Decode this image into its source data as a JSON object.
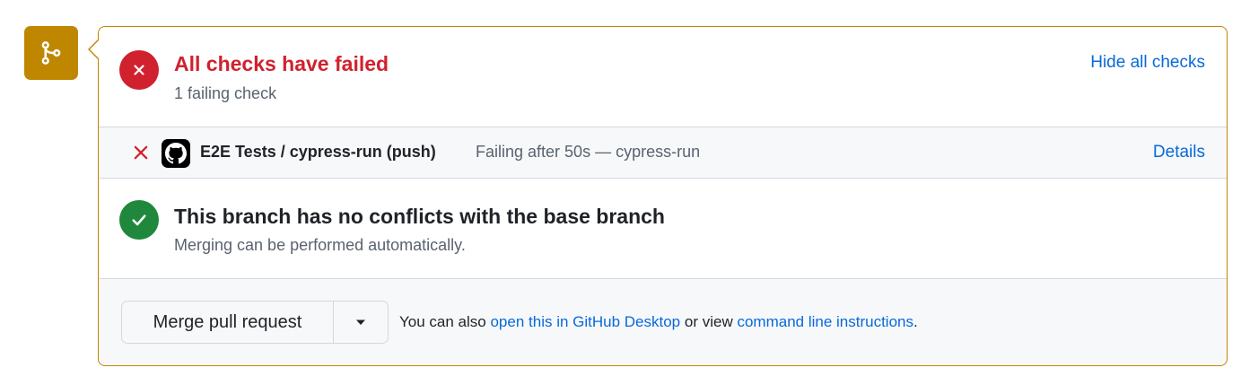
{
  "checks": {
    "title": "All checks have failed",
    "subtitle": "1 failing check",
    "toggle_label": "Hide all checks",
    "items": [
      {
        "name": "E2E Tests / cypress-run (push)",
        "description": "Failing after 50s — cypress-run",
        "details_label": "Details",
        "status": "failed",
        "icon": "github-icon"
      }
    ]
  },
  "branch": {
    "title": "This branch has no conflicts with the base branch",
    "subtitle": "Merging can be performed automatically."
  },
  "merge": {
    "button_label": "Merge pull request",
    "note_prefix": "You can also",
    "desktop_link": "open this in GitHub Desktop",
    "note_middle": "or view",
    "cli_link": "command line instructions",
    "note_suffix": "."
  },
  "colors": {
    "merge_badge": "#bf8700",
    "fail": "#cf222e",
    "success": "#1f883d",
    "link": "#0969da"
  }
}
